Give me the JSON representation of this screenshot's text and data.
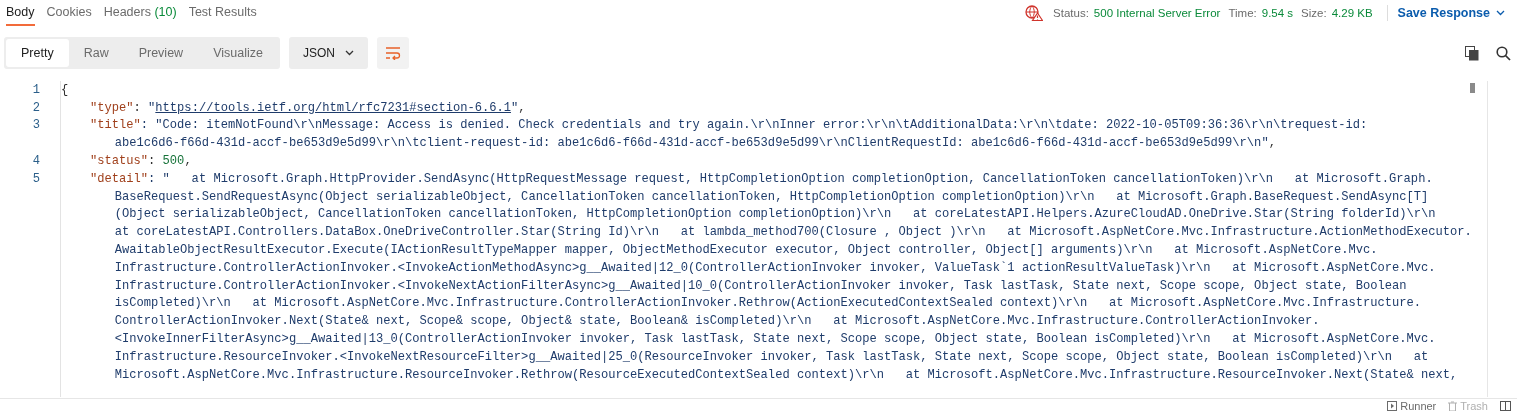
{
  "response_tabs": [
    {
      "label": "Body",
      "selected": true
    },
    {
      "label": "Cookies",
      "selected": false
    },
    {
      "label": "Headers",
      "count": "(10)",
      "selected": false
    },
    {
      "label": "Test Results",
      "selected": false
    }
  ],
  "status": {
    "status_label": "Status:",
    "status_value": "500 Internal Server Error",
    "time_label": "Time:",
    "time_value": "9.54 s",
    "size_label": "Size:",
    "size_value": "4.29 KB",
    "save_button": "Save Response"
  },
  "view_modes": [
    {
      "label": "Pretty",
      "selected": true
    },
    {
      "label": "Raw",
      "selected": false
    },
    {
      "label": "Preview",
      "selected": false
    },
    {
      "label": "Visualize",
      "selected": false
    }
  ],
  "format_dropdown": "JSON",
  "code_lines": [
    {
      "number": "1",
      "rows": [
        [
          {
            "kind": "punct",
            "text": "{"
          }
        ]
      ]
    },
    {
      "number": "2",
      "rows": [
        [
          {
            "kind": "key",
            "text": "\"type\""
          },
          {
            "kind": "punct",
            "text": ": "
          },
          {
            "kind": "string",
            "text": "\""
          },
          {
            "kind": "link",
            "text": "https://tools.ietf.org/html/rfc7231#section-6.6.1"
          },
          {
            "kind": "string",
            "text": "\""
          },
          {
            "kind": "punct",
            "text": ","
          }
        ]
      ]
    },
    {
      "number": "3",
      "rows": [
        [
          {
            "kind": "key",
            "text": "\"title\""
          },
          {
            "kind": "string",
            "text": ": \"Code: itemNotFound\\r\\nMessage: Access is denied. Check credentials and try again.\\r\\nInner error:\\r\\n\\tAdditionalData:\\r\\n\\tdate: 2022-10-05T09:36:36\\r\\n\\trequest-id:"
          }
        ],
        [
          {
            "kind": "string",
            "text": "abe1c6d6-f66d-431d-accf-be653d9e5d99\\r\\n\\tclient-request-id: abe1c6d6-f66d-431d-accf-be653d9e5d99\\r\\nClientRequestId: abe1c6d6-f66d-431d-accf-be653d9e5d99\\r\\n\""
          },
          {
            "kind": "punct",
            "text": ","
          }
        ]
      ]
    },
    {
      "number": "4",
      "rows": [
        [
          {
            "kind": "key",
            "text": "\"status\""
          },
          {
            "kind": "punct",
            "text": ": "
          },
          {
            "kind": "number",
            "text": "500"
          },
          {
            "kind": "punct",
            "text": ","
          }
        ]
      ]
    },
    {
      "number": "5",
      "rows": [
        [
          {
            "kind": "key",
            "text": "\"detail\""
          },
          {
            "kind": "string",
            "text": ": \"   at Microsoft.Graph.HttpProvider.SendAsync(HttpRequestMessage request, HttpCompletionOption completionOption, CancellationToken cancellationToken)\\r\\n   at Microsoft.Graph."
          }
        ],
        [
          {
            "kind": "string",
            "text": "BaseRequest.SendRequestAsync(Object serializableObject, CancellationToken cancellationToken, HttpCompletionOption completionOption)\\r\\n   at Microsoft.Graph.BaseRequest.SendAsync[T]"
          }
        ],
        [
          {
            "kind": "string",
            "text": "(Object serializableObject, CancellationToken cancellationToken, HttpCompletionOption completionOption)\\r\\n   at coreLatestAPI.Helpers.AzureCloudAD.OneDrive.Star(String folderId)\\r\\n"
          }
        ],
        [
          {
            "kind": "string",
            "text": "at coreLatestAPI.Controllers.DataBox.OneDriveController.Star(String Id)\\r\\n   at lambda_method700(Closure , Object )\\r\\n   at Microsoft.AspNetCore.Mvc.Infrastructure.ActionMethodExecutor."
          }
        ],
        [
          {
            "kind": "string",
            "text": "AwaitableObjectResultExecutor.Execute(IActionResultTypeMapper mapper, ObjectMethodExecutor executor, Object controller, Object[] arguments)\\r\\n   at Microsoft.AspNetCore.Mvc."
          }
        ],
        [
          {
            "kind": "string",
            "text": "Infrastructure.ControllerActionInvoker.<InvokeActionMethodAsync>g__Awaited|12_0(ControllerActionInvoker invoker, ValueTask`1 actionResultValueTask)\\r\\n   at Microsoft.AspNetCore.Mvc."
          }
        ],
        [
          {
            "kind": "string",
            "text": "Infrastructure.ControllerActionInvoker.<InvokeNextActionFilterAsync>g__Awaited|10_0(ControllerActionInvoker invoker, Task lastTask, State next, Scope scope, Object state, Boolean"
          }
        ],
        [
          {
            "kind": "string",
            "text": "isCompleted)\\r\\n   at Microsoft.AspNetCore.Mvc.Infrastructure.ControllerActionInvoker.Rethrow(ActionExecutedContextSealed context)\\r\\n   at Microsoft.AspNetCore.Mvc.Infrastructure."
          }
        ],
        [
          {
            "kind": "string",
            "text": "ControllerActionInvoker.Next(State& next, Scope& scope, Object& state, Boolean& isCompleted)\\r\\n   at Microsoft.AspNetCore.Mvc.Infrastructure.ControllerActionInvoker."
          }
        ],
        [
          {
            "kind": "string",
            "text": "<InvokeInnerFilterAsync>g__Awaited|13_0(ControllerActionInvoker invoker, Task lastTask, State next, Scope scope, Object state, Boolean isCompleted)\\r\\n   at Microsoft.AspNetCore.Mvc."
          }
        ],
        [
          {
            "kind": "string",
            "text": "Infrastructure.ResourceInvoker.<InvokeNextResourceFilter>g__Awaited|25_0(ResourceInvoker invoker, Task lastTask, State next, Scope scope, Object state, Boolean isCompleted)\\r\\n   at"
          }
        ],
        [
          {
            "kind": "string",
            "text": "Microsoft.AspNetCore.Mvc.Infrastructure.ResourceInvoker.Rethrow(ResourceExecutedContextSealed context)\\r\\n   at Microsoft.AspNetCore.Mvc.Infrastructure.ResourceInvoker.Next(State& next,"
          }
        ]
      ]
    }
  ],
  "footer_buttons": [
    {
      "label": "Runner",
      "kind": "runner"
    },
    {
      "label": "Trash",
      "kind": "trash"
    }
  ]
}
